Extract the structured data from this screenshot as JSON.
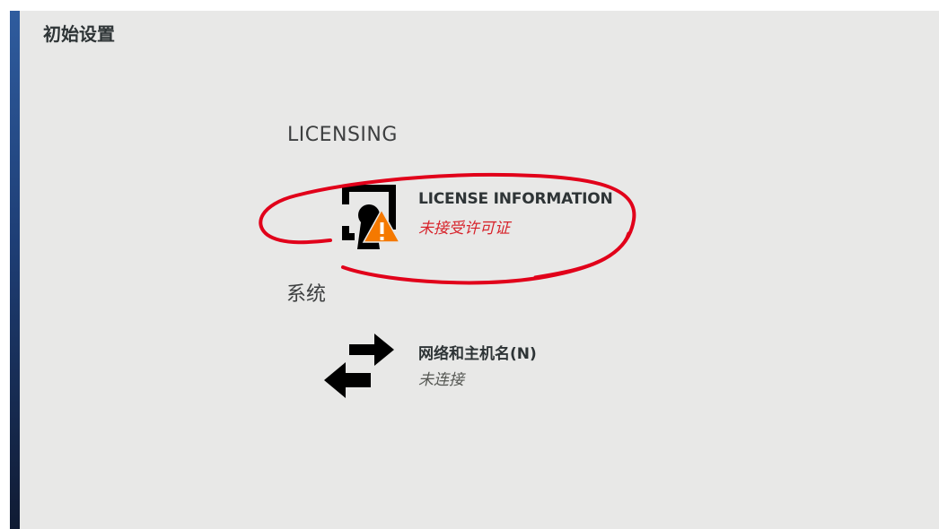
{
  "window": {
    "title": "初始设置"
  },
  "sections": {
    "licensing": {
      "heading": "LICENSING",
      "spoke": {
        "title": "LICENSE INFORMATION",
        "status": "未接受许可证",
        "icon": "license-warning-icon"
      }
    },
    "system": {
      "heading": "系统",
      "spoke": {
        "title": "网络和主机名(N)",
        "status": "未连接",
        "icon": "network-arrows-icon"
      }
    }
  },
  "colors": {
    "panel_background": "#e8e8e7",
    "sidebar_top": "#2f5c9e",
    "sidebar_bottom": "#101b33",
    "warning_status": "#d7232b",
    "warning_triangle": "#f57900",
    "annotation_stroke": "#e1001a"
  }
}
